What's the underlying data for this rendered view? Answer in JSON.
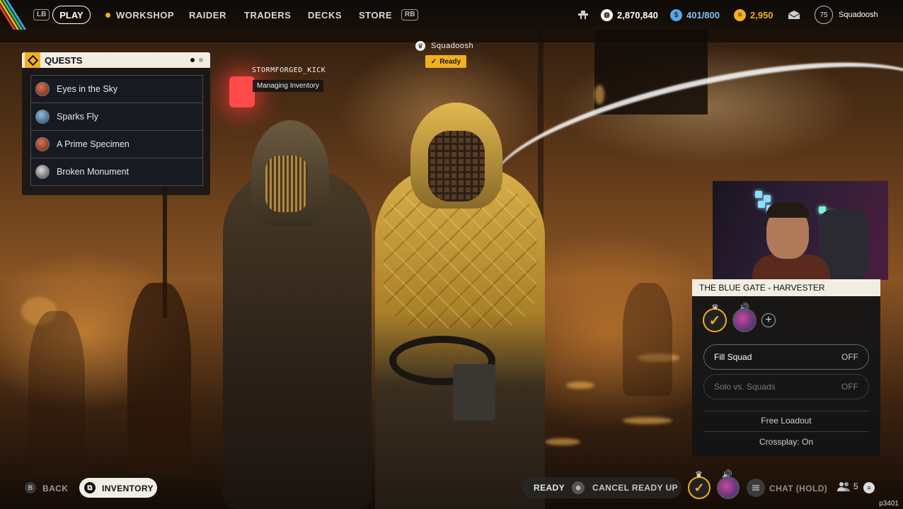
{
  "top_nav": {
    "lb": "LB",
    "rb": "RB",
    "play": "PLAY",
    "items": [
      "WORKSHOP",
      "RAIDER",
      "TRADERS",
      "DECKS",
      "STORE"
    ],
    "currency_coins": "2,870,840",
    "currency_capacity": "401/800",
    "currency_credits": "2,950",
    "player_level": "75",
    "player_name": "Squadoosh"
  },
  "quests": {
    "title": "QUESTS",
    "items": [
      "Eyes in the Sky",
      "Sparks Fly",
      "A Prime Specimen",
      "Broken Monument"
    ]
  },
  "players": {
    "left_name": "STORMFORGED_KICK",
    "left_status": "Managing Inventory",
    "right_name": "Squadoosh",
    "right_status": "Ready"
  },
  "squad": {
    "title": "THE BLUE GATE - HARVESTER",
    "fill_label": "Fill Squad",
    "fill_value": "OFF",
    "solo_label": "Solo vs. Squads",
    "solo_value": "OFF",
    "free_loadout": "Free Loadout",
    "crossplay": "Crossplay: On"
  },
  "bottom": {
    "back_key": "B",
    "back": "BACK",
    "inventory": "INVENTORY",
    "ready": "READY",
    "cancel": "CANCEL READY UP",
    "chat": "CHAT (HOLD)",
    "party_count": "5",
    "version": "p3401"
  },
  "colors": {
    "accent": "#f2b01e",
    "panel_header": "#f1ede3"
  }
}
